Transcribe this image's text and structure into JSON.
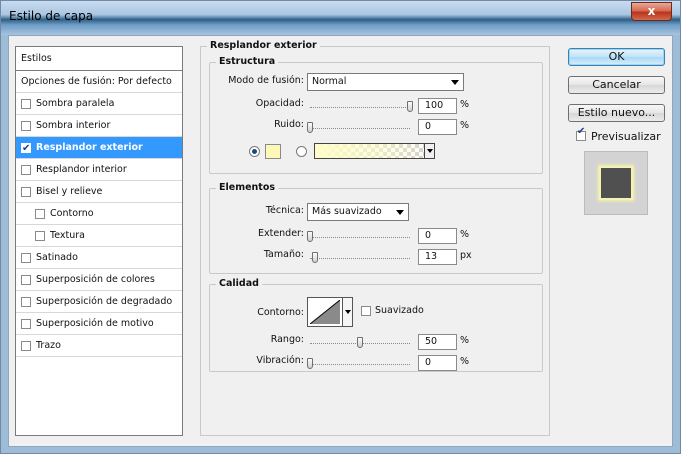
{
  "window": {
    "title": "Estilo de capa",
    "close_label": "x"
  },
  "styles_list": {
    "header": "Estilos",
    "blend_options": "Opciones de fusión: Por defecto",
    "items": [
      {
        "label": "Sombra paralela",
        "checked": false,
        "selected": false
      },
      {
        "label": "Sombra interior",
        "checked": false,
        "selected": false
      },
      {
        "label": "Resplandor exterior",
        "checked": true,
        "selected": true
      },
      {
        "label": "Resplandor interior",
        "checked": false,
        "selected": false
      },
      {
        "label": "Bisel y relieve",
        "checked": false,
        "selected": false
      },
      {
        "label": "Contorno",
        "checked": false,
        "selected": false
      },
      {
        "label": "Textura",
        "checked": false,
        "selected": false
      },
      {
        "label": "Satinado",
        "checked": false,
        "selected": false
      },
      {
        "label": "Superposición de colores",
        "checked": false,
        "selected": false
      },
      {
        "label": "Superposición de degradado",
        "checked": false,
        "selected": false
      },
      {
        "label": "Superposición de motivo",
        "checked": false,
        "selected": false
      },
      {
        "label": "Trazo",
        "checked": false,
        "selected": false
      }
    ]
  },
  "panel": {
    "title": "Resplandor exterior",
    "structure": {
      "title": "Estructura",
      "blend_mode_label": "Modo de fusión:",
      "blend_mode_value": "Normal",
      "opacity_label": "Opacidad:",
      "opacity_value": "100",
      "opacity_unit": "%",
      "opacity_level": 1.0,
      "noise_label": "Ruido:",
      "noise_value": "0",
      "noise_unit": "%",
      "noise_level": 0.0,
      "color_mode": "solid",
      "glow_color": "#fdf8b8"
    },
    "elements": {
      "title": "Elementos",
      "technique_label": "Técnica:",
      "technique_value": "Más suavizado",
      "spread_label": "Extender:",
      "spread_value": "0",
      "spread_unit": "%",
      "spread_level": 0.0,
      "size_label": "Tamaño:",
      "size_value": "13",
      "size_unit": "px",
      "size_level": 0.052
    },
    "quality": {
      "title": "Calidad",
      "contour_label": "Contorno:",
      "antialias_label": "Suavizado",
      "antialias_checked": false,
      "range_label": "Rango:",
      "range_value": "50",
      "range_unit": "%",
      "range_level": 0.5,
      "jitter_label": "Vibración:",
      "jitter_value": "0",
      "jitter_unit": "%",
      "jitter_level": 0.0
    }
  },
  "buttons": {
    "ok": "OK",
    "cancel": "Cancelar",
    "new_style": "Estilo nuevo...",
    "preview_label": "Previsualizar",
    "preview_checked": true
  },
  "colors": {
    "selection": "#3399ff",
    "glow": "#fdf8b8",
    "preview_fill": "#505050"
  }
}
